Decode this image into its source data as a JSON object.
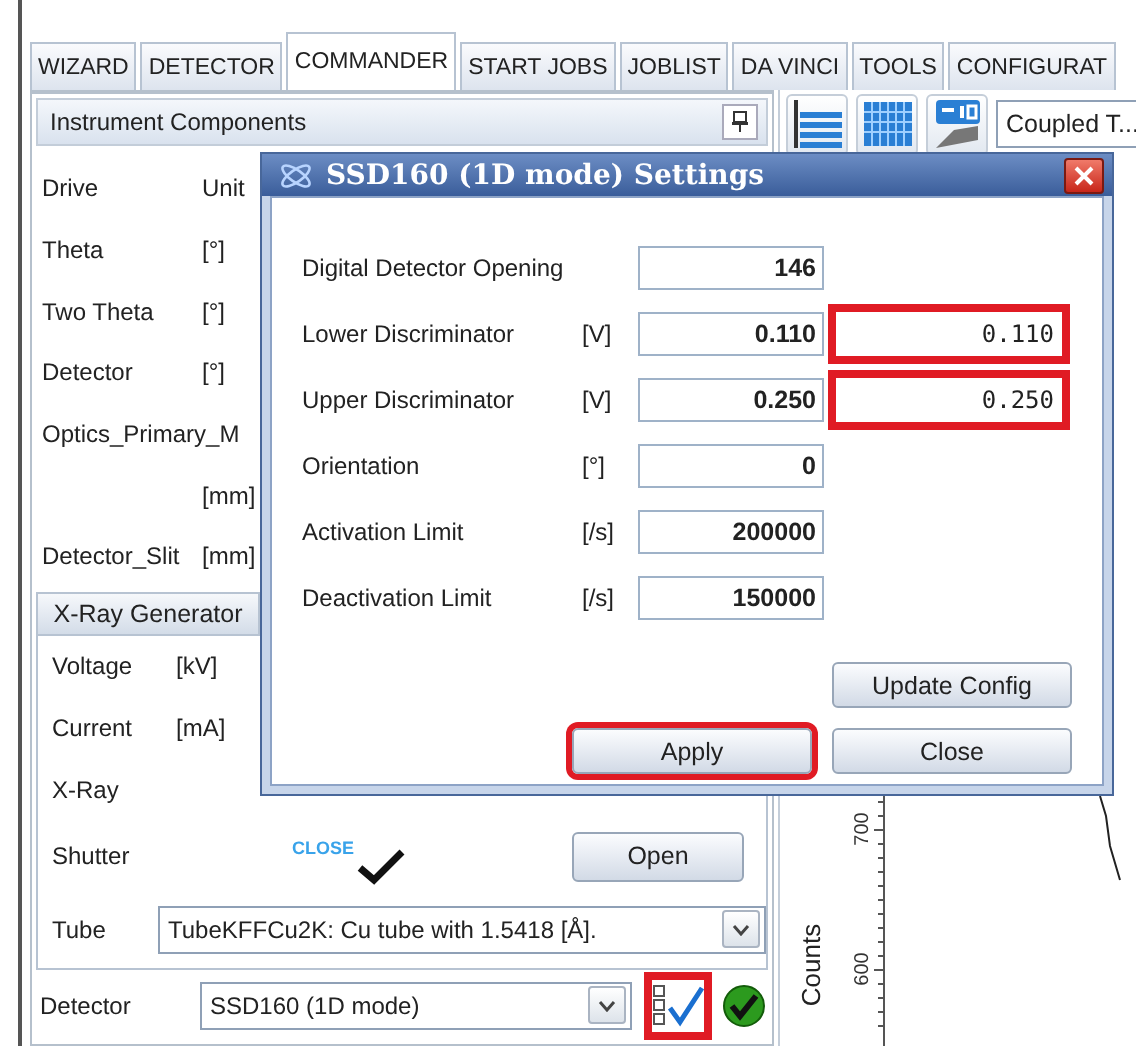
{
  "tabs": [
    {
      "label": "WIZARD",
      "selected": false
    },
    {
      "label": "DETECTOR",
      "selected": false
    },
    {
      "label": "COMMANDER",
      "selected": true
    },
    {
      "label": "START JOBS",
      "selected": false
    },
    {
      "label": "JOBLIST",
      "selected": false
    },
    {
      "label": "DA VINCI",
      "selected": false
    },
    {
      "label": "TOOLS",
      "selected": false
    },
    {
      "label": "CONFIGURAT",
      "selected": false
    }
  ],
  "instrument_components": {
    "title": "Instrument Components",
    "rows": [
      {
        "label": "Drive",
        "unit": "Unit"
      },
      {
        "label": "Theta",
        "unit": "[°]"
      },
      {
        "label": "Two Theta",
        "unit": "[°]"
      },
      {
        "label": "Detector",
        "unit": "[°]"
      },
      {
        "label": "Optics_Primary_M"
      },
      {
        "unit": "[mm]"
      },
      {
        "label": "Detector_Slit",
        "unit": "[mm]"
      }
    ]
  },
  "xray_generator": {
    "title": "X-Ray Generator",
    "rows": [
      {
        "label": "Voltage",
        "unit": "[kV]"
      },
      {
        "label": "Current",
        "unit": "[mA]"
      },
      {
        "label": "X-Ray"
      }
    ],
    "shutter": {
      "label": "Shutter",
      "state": "CLOSE",
      "button": "Open"
    },
    "tube": {
      "label": "Tube",
      "value": "TubeKFFCu2K: Cu tube with 1.5418 [Å]."
    }
  },
  "detector": {
    "label": "Detector",
    "value": "SSD160 (1D mode)",
    "settings_highlighted": true
  },
  "toolbar": {
    "scan_type": "Coupled T..."
  },
  "chart": {
    "ylabel": "Counts",
    "ticks": [
      "700",
      "600"
    ]
  },
  "dialog": {
    "title": "SSD160 (1D mode) Settings",
    "rows": [
      {
        "label": "Digital Detector Opening",
        "value": "146"
      },
      {
        "label": "Lower Discriminator",
        "unit": "[V]",
        "value": "0.110",
        "new_value": "0.110",
        "highlighted": true
      },
      {
        "label": "Upper Discriminator",
        "unit": "[V]",
        "value": "0.250",
        "new_value": "0.250",
        "highlighted": true
      },
      {
        "label": "Orientation",
        "unit": "[°]",
        "value": "0"
      },
      {
        "label": "Activation Limit",
        "unit": "[/s]",
        "value": "200000"
      },
      {
        "label": "Deactivation Limit",
        "unit": "[/s]",
        "value": "150000"
      }
    ],
    "button_rows": [
      [
        {
          "label": "Update Config",
          "highlighted": false
        }
      ],
      [
        {
          "label": "Apply",
          "highlighted": true
        },
        {
          "label": "Close",
          "highlighted": false
        }
      ]
    ]
  }
}
